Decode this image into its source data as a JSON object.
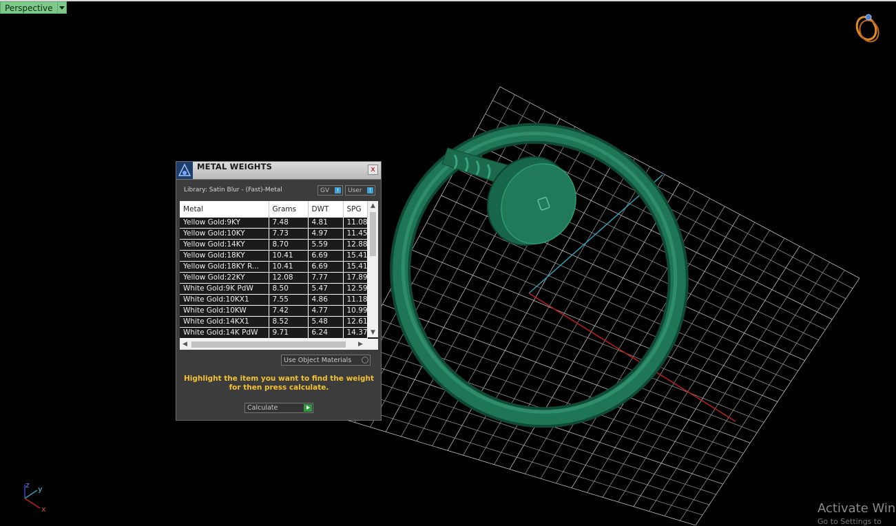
{
  "viewport": {
    "name": "Perspective",
    "accent": "#7dc98a",
    "gizmo": {
      "z": "z",
      "y": "y",
      "x": "x"
    }
  },
  "model": {
    "color": "#1d6b4f",
    "description_icon": "ring-icon"
  },
  "dialog": {
    "title": "METAL WEIGHTS",
    "close_label": "x",
    "library_label": "Library: Satin Blur - (Fast)-Metal",
    "toggles": [
      {
        "label": "GV",
        "knob": "!"
      },
      {
        "label": "User",
        "knob": "!"
      }
    ],
    "table": {
      "columns": [
        "Metal",
        "Grams",
        "DWT",
        "SPG"
      ],
      "rows": [
        [
          "Yellow Gold:9KY",
          "7.48",
          "4.81",
          "11.08"
        ],
        [
          "Yellow Gold:10KY",
          "7.73",
          "4.97",
          "11.45"
        ],
        [
          "Yellow Gold:14KY",
          "8.70",
          "5.59",
          "12.88"
        ],
        [
          "Yellow Gold:18KY",
          "10.41",
          "6.69",
          "15.41"
        ],
        [
          "Yellow Gold:18KY R...",
          "10.41",
          "6.69",
          "15.41"
        ],
        [
          "Yellow Gold:22KY",
          "12.08",
          "7.77",
          "17.89"
        ],
        [
          "White Gold:9K PdW",
          "8.50",
          "5.47",
          "12.59"
        ],
        [
          "White Gold:10KX1",
          "7.55",
          "4.86",
          "11.18"
        ],
        [
          "White Gold:10KW",
          "7.42",
          "4.77",
          "10.99"
        ],
        [
          "White Gold:14KX1",
          "8.52",
          "5.48",
          "12.61"
        ],
        [
          "White Gold:14K PdW",
          "9.71",
          "6.24",
          "14.37"
        ]
      ]
    },
    "use_object_materials_label": "Use Object Materials",
    "hint": "Highlight the item you want to find the weight for then press calculate.",
    "calculate_label": "Calculate",
    "hint_color": "#f1c232"
  },
  "watermark": {
    "line1": "Activate Wind",
    "line2": "Go to Settings to"
  }
}
